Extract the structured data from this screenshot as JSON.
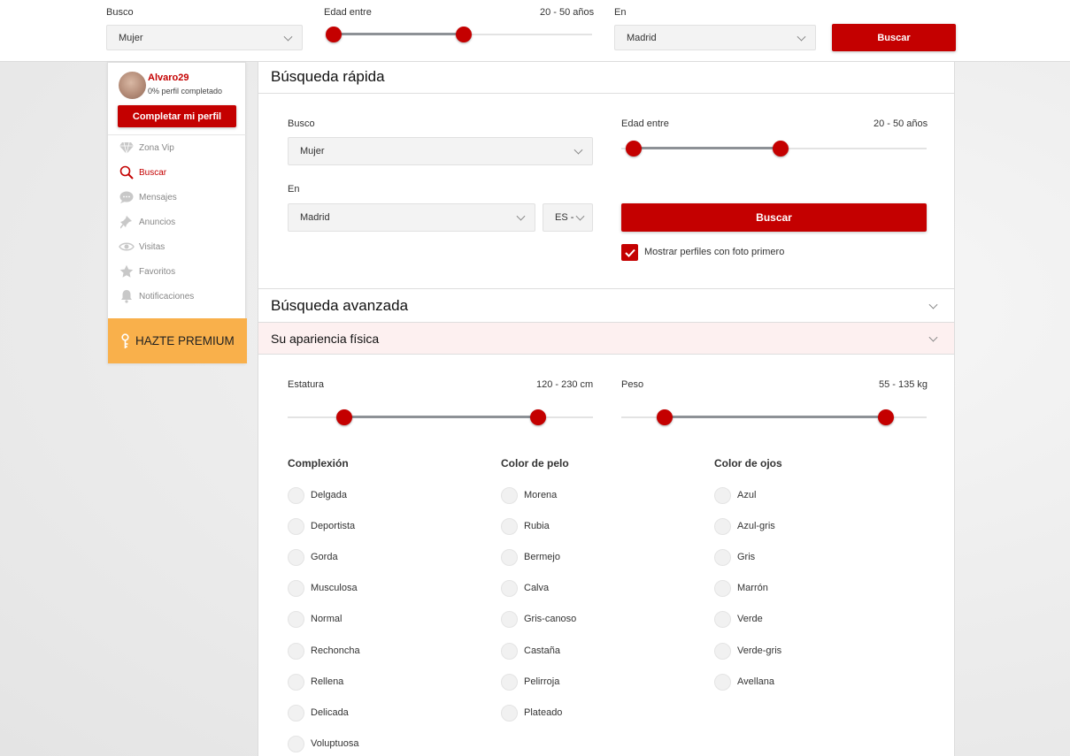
{
  "topbar": {
    "busco_label": "Busco",
    "busco_value": "Mujer",
    "edad_label": "Edad entre",
    "edad_value": "20 - 50 años",
    "en_label": "En",
    "en_value": "Madrid",
    "buscar_label": "Buscar",
    "edad_range_fraction": [
      0.0,
      0.5
    ]
  },
  "sidebar": {
    "username": "Alvaro29",
    "profile_progress": "0% perfil completado",
    "complete_button": "Completar mi perfil",
    "items": [
      {
        "label": "Zona Vip",
        "icon": "diamond-icon"
      },
      {
        "label": "Buscar",
        "icon": "search-icon"
      },
      {
        "label": "Mensajes",
        "icon": "chat-icon"
      },
      {
        "label": "Anuncios",
        "icon": "pin-icon"
      },
      {
        "label": "Visitas",
        "icon": "eye-icon"
      },
      {
        "label": "Favoritos",
        "icon": "star-icon"
      },
      {
        "label": "Notificaciones",
        "icon": "bell-icon"
      }
    ],
    "active_item": "Buscar",
    "premium_label": "HAZTE PREMIUM"
  },
  "quick_search": {
    "title": "Búsqueda rápida",
    "busco_label": "Busco",
    "busco_value": "Mujer",
    "edad_label": "Edad entre",
    "edad_value": "20 - 50 años",
    "en_label": "En",
    "en_value": "Madrid",
    "country_value": "ES -",
    "buscar_label": "Buscar",
    "photo_first_label": "Mostrar perfiles con foto primero",
    "photo_first_checked": true
  },
  "advanced": {
    "title": "Búsqueda avanzada",
    "appearance_title": "Su apariencia física",
    "estatura_label": "Estatura",
    "estatura_value": "120 - 230 cm",
    "peso_label": "Peso",
    "peso_value": "55 - 135 kg",
    "complexion": {
      "heading": "Complexión",
      "options": [
        "Delgada",
        "Deportista",
        "Gorda",
        "Musculosa",
        "Normal",
        "Rechoncha",
        "Rellena",
        "Delicada",
        "Voluptuosa"
      ]
    },
    "hair_color": {
      "heading": "Color de pelo",
      "options": [
        "Morena",
        "Rubia",
        "Bermejo",
        "Calva",
        "Gris-canoso",
        "Castaña",
        "Pelirroja",
        "Plateado"
      ]
    },
    "eye_color": {
      "heading": "Color de ojos",
      "options": [
        "Azul",
        "Azul-gris",
        "Gris",
        "Marrón",
        "Verde",
        "Verde-gris",
        "Avellana"
      ]
    }
  },
  "colors": {
    "accent": "#c40000",
    "premium": "#f9b04b",
    "accordion_highlight": "#fdf0f0"
  }
}
